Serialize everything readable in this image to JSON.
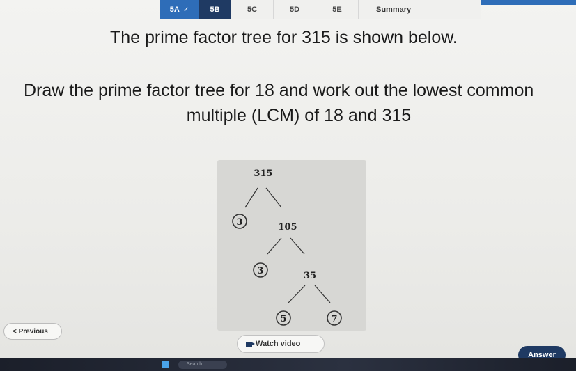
{
  "tabs": [
    {
      "label": "5A",
      "state": "done",
      "icon": "check-icon"
    },
    {
      "label": "5B",
      "state": "active"
    },
    {
      "label": "5C",
      "state": "normal"
    },
    {
      "label": "5D",
      "state": "normal"
    },
    {
      "label": "5E",
      "state": "normal"
    },
    {
      "label": "Summary",
      "state": "normal"
    }
  ],
  "question": {
    "line1": "The prime factor tree for 315 is shown below.",
    "line2a": "Draw the prime factor tree for 18 and work out the lowest common",
    "line2b": "multiple (LCM) of 18 and 315"
  },
  "tree": {
    "root": "315",
    "nodes": [
      {
        "left": "3",
        "right": "105",
        "left_prime": true
      },
      {
        "left": "3",
        "right": "35",
        "left_prime": true
      },
      {
        "left": "5",
        "right": "7",
        "left_prime": true,
        "right_prime": true
      }
    ]
  },
  "controls": {
    "previous": "< Previous",
    "watch_video": "Watch video",
    "answer": "Answer"
  },
  "taskbar": {
    "search_placeholder": "Search"
  },
  "colors": {
    "accent": "#1f3a63",
    "tab_done": "#2e6db8"
  }
}
